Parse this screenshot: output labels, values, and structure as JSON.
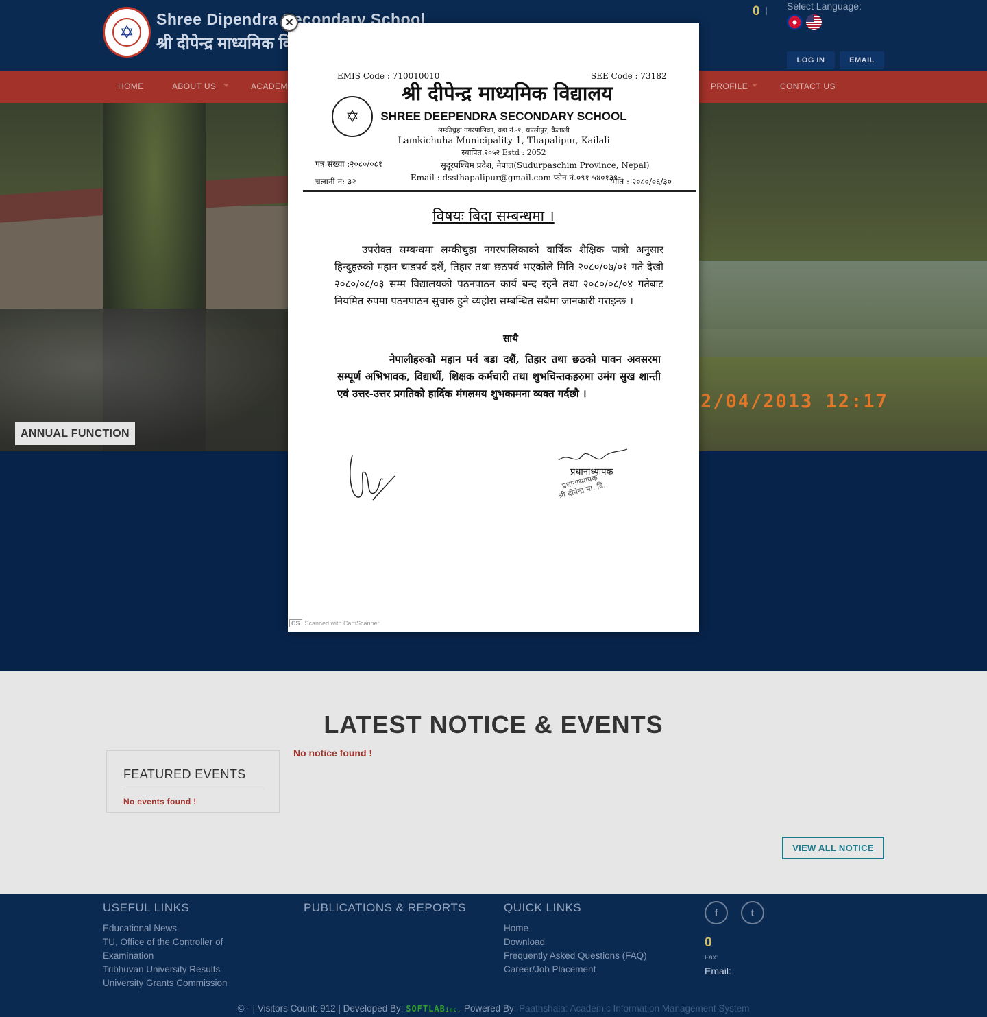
{
  "header": {
    "school_name_en": "Shree Dipendra Secondary School",
    "school_name_np": "श्री दीपेन्द्र माध्यमिक विद्यालय",
    "counter": "0",
    "language_label": "Select Language:",
    "languages": [
      "Nepali",
      "English"
    ],
    "login_label": "LOG IN",
    "email_label": "EMAIL"
  },
  "nav": {
    "items": [
      {
        "label": "HOME",
        "has_dropdown": false
      },
      {
        "label": "ABOUT US",
        "has_dropdown": true
      },
      {
        "label": "ACADEMI",
        "has_dropdown": false
      },
      {
        "label": "PROFILE",
        "has_dropdown": true
      },
      {
        "label": "CONTACT US",
        "has_dropdown": false
      }
    ]
  },
  "slider": {
    "caption": "ANNUAL FUNCTION",
    "timestamp": "2/04/2013 12:17"
  },
  "notices": {
    "section_title": "LATEST NOTICE & EVENTS",
    "featured_title": "FEATURED EVENTS",
    "no_events": "No events found !",
    "no_notice": "No notice found !",
    "view_all_label": "VIEW ALL NOTICE"
  },
  "modal": {
    "close_symbol": "✕",
    "emis": "EMIS Code : 710010010",
    "see": "SEE Code : 73182",
    "name_np": "श्री दीपेन्द्र माध्यमिक विद्यालय",
    "name_en": "SHREE DEEPENDRA SECONDARY SCHOOL",
    "address_np": "लम्कीचुहा नगरपालिका, वडा नं.-१, थपलीपुर, कैलाली",
    "address_en": "Lamkichuha Municipality-1, Thapalipur, Kailali",
    "estd": "स्थापित:२०५२ Estd : 2052",
    "patra_sankhya": "पत्र संख्या :२०८०/०८१",
    "province": "सुदूरपश्चिम प्रदेश, नेपाल(Sudurpaschim Province, Nepal)",
    "chalani": "चलानी नं: ३२",
    "email_phone": "Email : dssthapalipur@gmail.com फोन नं.०९१-५४०१३९",
    "date": "मिति : २०८०/०६/३०",
    "subject": "विषयः बिदा सम्बन्धमा ।",
    "body": "उपरोक्त सम्बन्धमा लम्कीचुहा नगरपालिकाको वार्षिक शैक्षिक पात्रो अनुसार हिन्दुहरुको महान चाडपर्व दशैं, तिहार तथा छठपर्व भएकोले मिति २०८०/०७/०१ गते देखी २०८०/०८/०३ सम्म विद्यालयको पठनपाठन कार्य बन्द रहने तथा २०८०/०८/०४ गतेबाट नियमित रुपमा पठनपाठन सुचारु हुने व्यहोरा सम्बन्धित सबैमा जानकारी गराइन्छ ।",
    "greeting": "साथै",
    "wishes": "नेपालीहरुको महान पर्व बडा दशैं, तिहार तथा छठको पावन अवसरमा सम्पूर्ण अभिभावक, विद्यार्थी, शिक्षक कर्मचारी तथा शुभचिन्तकहरुमा उमंग सुख शान्ती एवं उत्तर-उत्तर प्रगतिको हार्दिक मंगलमय शुभकामना व्यक्त गर्दछौ ।",
    "principal": "प्रधानाध्यापक",
    "stamp_lines": [
      "प्रधानाध्यापक",
      "श्री दीपेन्द्र मा. वि."
    ],
    "scanned": "Scanned with CamScanner"
  },
  "footer": {
    "useful_links_title": "USEFUL LINKS",
    "useful_links": [
      "Educational News",
      "TU, Office of the Controller of",
      "Examination",
      "Tribhuvan University Results",
      "University Grants Commission"
    ],
    "publications_title": "PUBLICATIONS & REPORTS",
    "quick_links_title": "QUICK LINKS",
    "quick_links": [
      "Home",
      "Download",
      "Frequently Asked Questions (FAQ)",
      "Career/Job Placement"
    ],
    "social": [
      "f",
      "t"
    ],
    "phone": "0",
    "fax_label": "Fax:",
    "email_label": "Email:",
    "copyright_prefix": "© - | Visitors Count: 912 | Developed By:",
    "developer": "SOFTLAB",
    "developer_suffix": "inc.",
    "powered_label": "Powered By:",
    "powered_by": "Paathshala: Academic Information Management System"
  },
  "colors": {
    "header_bg": "#0a2a52",
    "nav_bg": "#a3322a",
    "accent_red": "#a3322a",
    "accent_teal": "#1b7a8a",
    "page_bg": "#e6e6e6"
  }
}
